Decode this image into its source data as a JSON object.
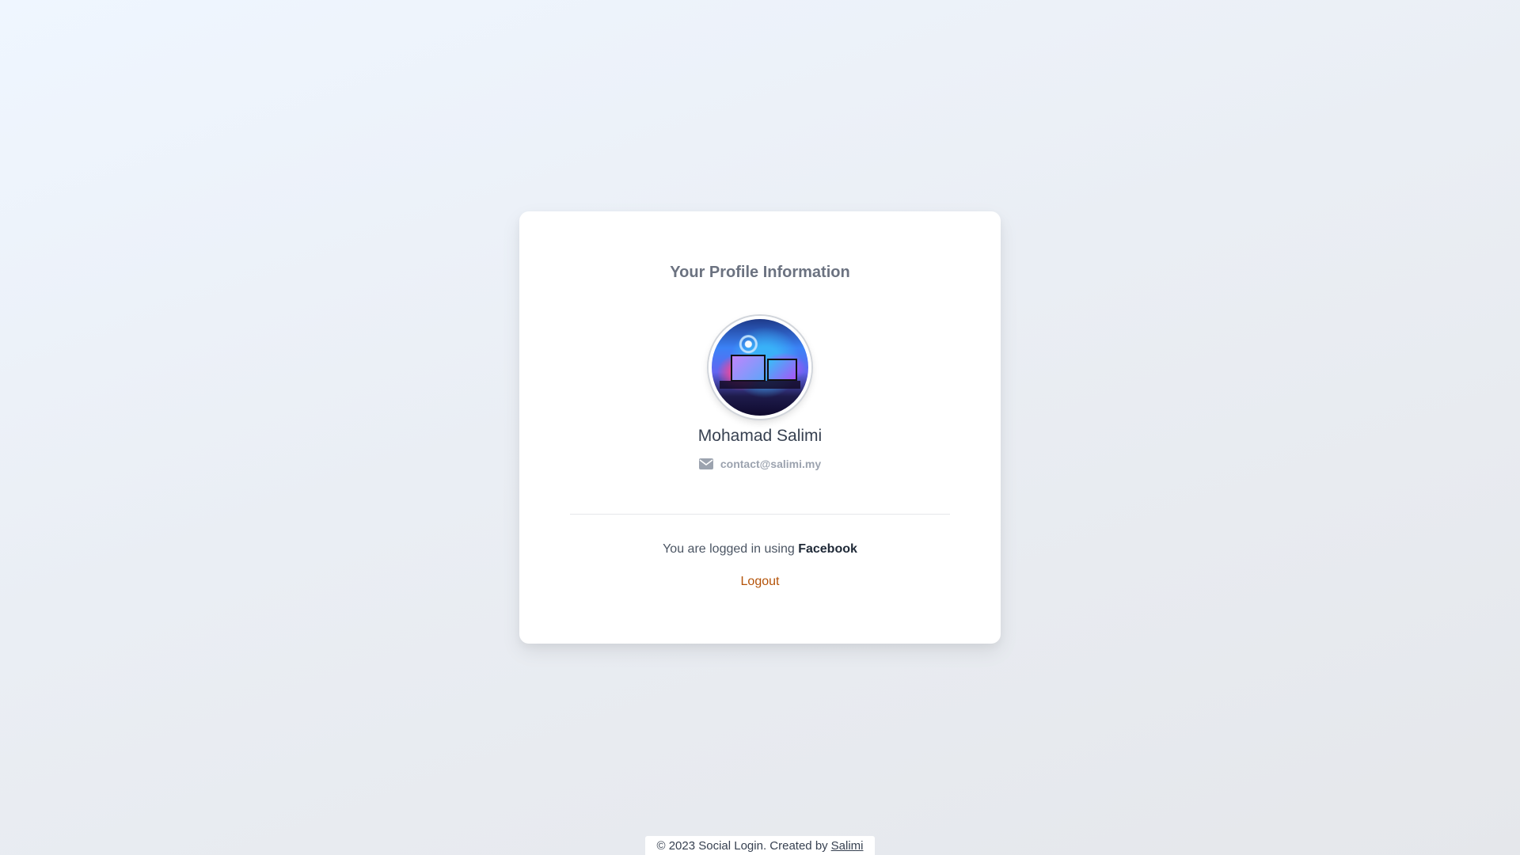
{
  "profile": {
    "title": "Your Profile Information",
    "name": "Mohamad Salimi",
    "email": "contact@salimi.my",
    "email_icon": "envelope-icon"
  },
  "login": {
    "prefix": "You are logged in using",
    "provider": "Facebook",
    "logout_label": "Logout"
  },
  "footer": {
    "text": "© 2023 Social Login. Created by",
    "author_link": "Salimi"
  },
  "colors": {
    "logout": "#b45309",
    "title": "#6b7280",
    "card_bg": "#ffffff"
  }
}
